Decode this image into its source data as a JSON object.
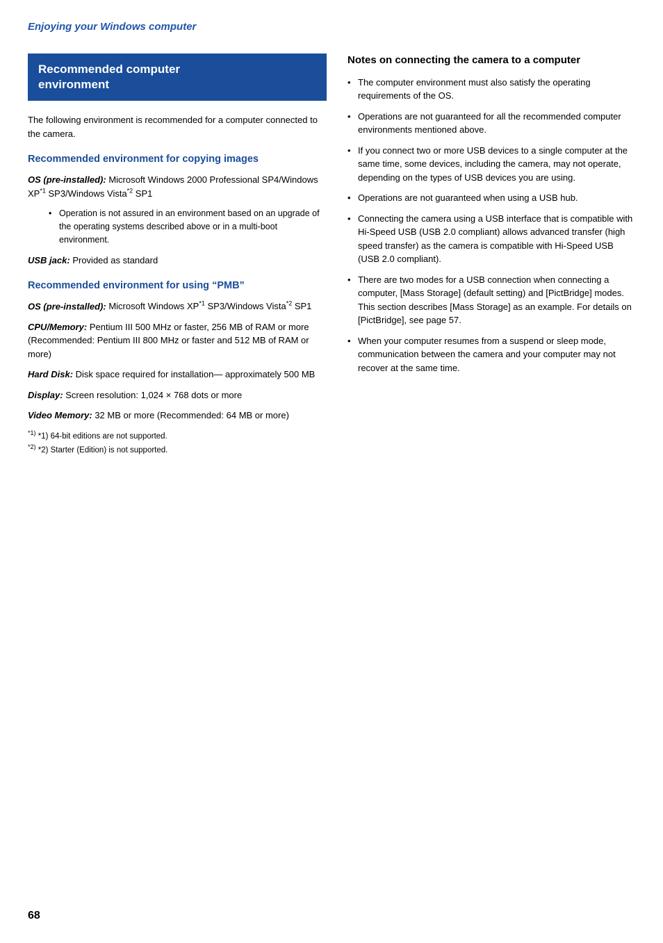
{
  "header": {
    "title": "Enjoying your Windows computer"
  },
  "page_number": "68",
  "left_column": {
    "section_box_line1": "Recommended computer",
    "section_box_line2": "environment",
    "intro_text": "The following environment is recommended for a computer connected to the camera.",
    "subsection1": {
      "title": "Recommended environment for copying images",
      "os_label": "OS (pre-installed):",
      "os_value": "Microsoft Windows 2000 Professional SP4/Windows XP*1 SP3/Windows Vista*2 SP1",
      "os_note": "Operation is not assured in an environment based on an upgrade of the operating systems described above or in a multi-boot environment.",
      "usb_label": "USB jack:",
      "usb_value": "Provided as standard"
    },
    "subsection2": {
      "title": "Recommended environment for using “PMB”",
      "os_label": "OS (pre-installed):",
      "os_value": "Microsoft Windows XP*1 SP3/Windows Vista*2 SP1",
      "cpu_label": "CPU/Memory:",
      "cpu_value": "Pentium III 500 MHz or faster, 256 MB of RAM or more (Recommended: Pentium III 800 MHz or faster and 512 MB of RAM or more)",
      "hdd_label": "Hard Disk:",
      "hdd_value": "Disk space required for installation— approximately 500 MB",
      "display_label": "Display:",
      "display_value": "Screen resolution: 1,024 × 768 dots or more",
      "video_label": "Video Memory:",
      "video_value": "32 MB or more (Recommended: 64 MB or more)"
    },
    "footnotes": [
      "*1) 64-bit editions are not supported.",
      "*2) Starter (Edition) is not supported."
    ]
  },
  "right_column": {
    "title": "Notes on connecting the camera to a computer",
    "bullets": [
      "The computer environment must also satisfy the operating requirements of the OS.",
      "Operations are not guaranteed for all the recommended computer environments mentioned above.",
      "If you connect two or more USB devices to a single computer at the same time, some devices, including the camera, may not operate, depending on the types of USB devices you are using.",
      "Operations are not guaranteed when using a USB hub.",
      "Connecting the camera using a USB interface that is compatible with Hi-Speed USB (USB 2.0 compliant) allows advanced transfer (high speed transfer) as the camera is compatible with Hi-Speed USB (USB 2.0 compliant).",
      "There are two modes for a USB connection when connecting a computer, [Mass Storage] (default setting) and [PictBridge] modes. This section describes [Mass Storage] as an example. For details on [PictBridge], see page 57.",
      "When your computer resumes from a suspend or sleep mode, communication between the camera and your computer may not recover at the same time."
    ]
  }
}
